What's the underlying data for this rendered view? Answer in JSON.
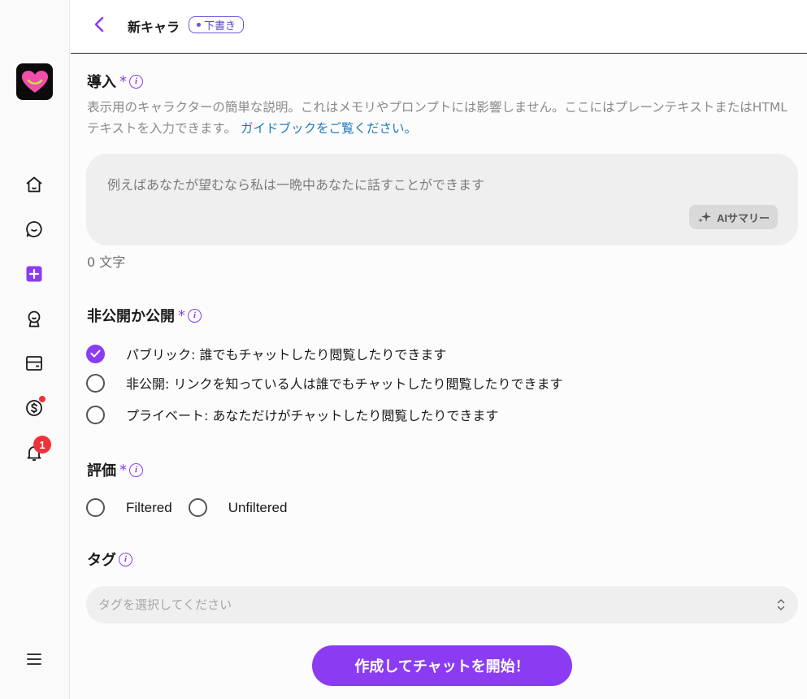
{
  "header": {
    "title": "新キャラ",
    "draft_badge": "下書き"
  },
  "sidebar": {
    "notification_count": "1",
    "items": [
      "home-icon",
      "chat-icon",
      "create-icon",
      "award-icon",
      "card-icon",
      "coin-icon",
      "bell-icon",
      "menu-icon"
    ]
  },
  "intro": {
    "title": "導入",
    "required": "*",
    "description": "表示用のキャラクターの簡単な説明。これはメモリやプロンプトには影響しません。ここにはプレーンテキストまたはHTMLテキストを入力できます。",
    "guide_link": "ガイドブックをご覧ください。",
    "placeholder": "例えばあなたが望むなら私は一晩中あなたに話すことができます",
    "ai_button": "AIサマリー",
    "char_count": "0 文字"
  },
  "visibility": {
    "title": "非公開か公開",
    "required": "*",
    "options": [
      {
        "label": "パブリック: 誰でもチャットしたり閲覧したりできます",
        "checked": true
      },
      {
        "label": "非公開: リンクを知っている人は誰でもチャットしたり閲覧したりできます",
        "checked": false
      },
      {
        "label": "プライベート: あなただけがチャットしたり閲覧したりできます",
        "checked": false
      }
    ]
  },
  "rating": {
    "title": "評価",
    "required": "*",
    "options": [
      {
        "label": "Filtered",
        "checked": false
      },
      {
        "label": "Unfiltered",
        "checked": false
      }
    ]
  },
  "tags": {
    "title": "タグ",
    "placeholder": "タグを選択してください"
  },
  "submit_label": "作成してチャットを開始！",
  "colors": {
    "accent": "#8b3cf2",
    "link": "#1f7bbd",
    "badge_red": "#ee3338"
  }
}
